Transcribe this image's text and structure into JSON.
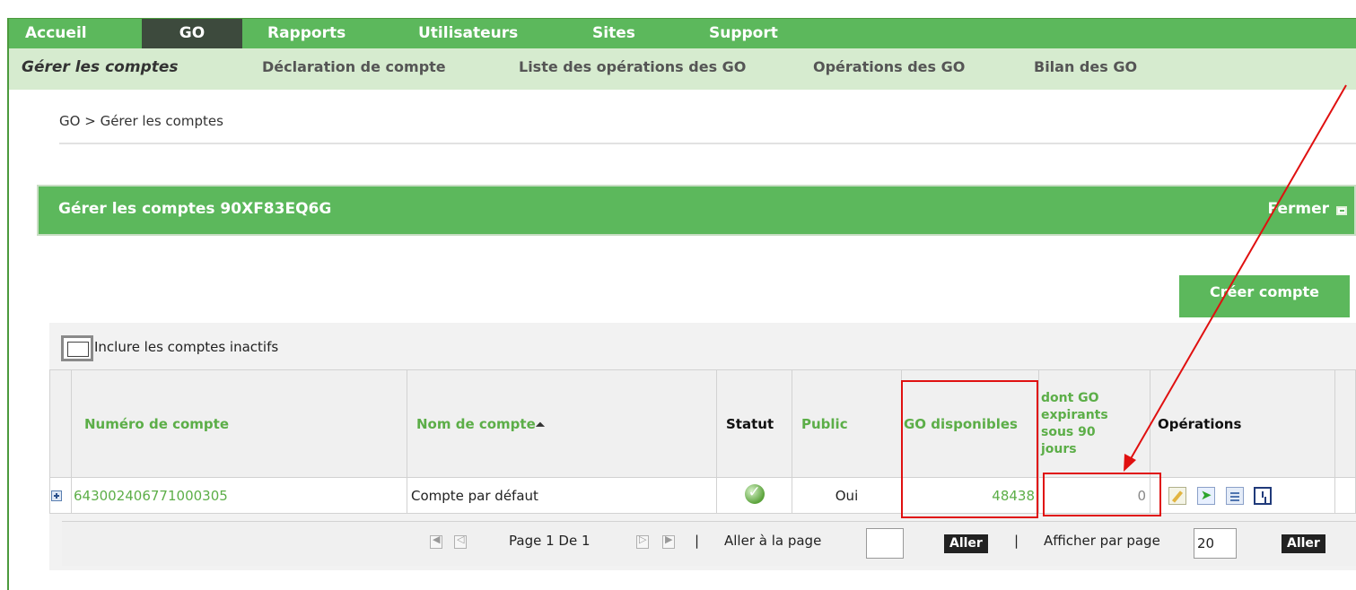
{
  "nav": {
    "items": [
      {
        "label": "Accueil"
      },
      {
        "label": "GO"
      },
      {
        "label": "Rapports"
      },
      {
        "label": "Utilisateurs"
      },
      {
        "label": "Sites"
      },
      {
        "label": "Support"
      }
    ],
    "active": "GO"
  },
  "subnav": {
    "items": [
      {
        "label": "Gérer les comptes"
      },
      {
        "label": "Déclaration de compte"
      },
      {
        "label": "Liste des opérations des GO"
      },
      {
        "label": "Opérations des GO"
      },
      {
        "label": "Bilan des GO"
      }
    ],
    "active": "Gérer les comptes"
  },
  "breadcrumb": {
    "root": "GO",
    "separator": ">",
    "current": "Gérer les comptes"
  },
  "panel": {
    "title": "Gérer les comptes 90XF83EQ6G",
    "close_label": "Fermer",
    "create_label": "Créer compte"
  },
  "filter": {
    "include_inactive_label": "Inclure les comptes inactifs",
    "include_inactive_checked": false
  },
  "table": {
    "columns": {
      "account_number": "Numéro de compte",
      "account_name": "Nom de compte",
      "status": "Statut",
      "public": "Public",
      "go_available": "GO disponibles",
      "go_expiring": "dont GO expirants sous 90 jours",
      "operations": "Opérations"
    },
    "sort_indicator": "⏶",
    "rows": [
      {
        "account_number": "643002406771000305",
        "account_name": "Compte par défaut",
        "status": "active",
        "public": "Oui",
        "go_available": "48438",
        "go_expiring": "0"
      }
    ],
    "operation_icons": [
      "edit-icon",
      "transfer-icon",
      "document-icon",
      "clock-icon"
    ]
  },
  "pager": {
    "page_label": "Page 1 De 1",
    "sep": "|",
    "goto_label": "Aller à la page",
    "goto_value": "",
    "go_label": "Aller",
    "per_page_label": "Afficher par page",
    "per_page_value": "20"
  },
  "colors": {
    "brand_green": "#5cb85c",
    "subnav_bg": "#d6ebcf",
    "link_green": "#5cae48",
    "annotation_red": "#e01010"
  }
}
